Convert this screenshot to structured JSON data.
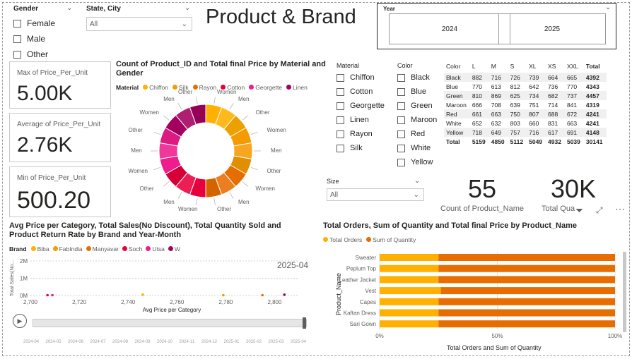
{
  "title": "Product & Brand",
  "gender_slicer": {
    "title": "Gender",
    "options": [
      "Female",
      "Male",
      "Other"
    ]
  },
  "state_slicer": {
    "title": "State, City",
    "value": "All"
  },
  "year_slicer": {
    "title": "Year",
    "options": [
      "2024",
      "2025"
    ]
  },
  "cards": [
    {
      "label": "Max of Price_Per_Unit",
      "value": "5.00K"
    },
    {
      "label": "Average of Price_Per_Unit",
      "value": "2.76K"
    },
    {
      "label": "Min of Price_Per_Unit",
      "value": "500.20"
    }
  ],
  "donut": {
    "title": "Count of Product_ID and Total final Price by Material and Gender",
    "legend_title": "Material",
    "legend": [
      "Chiffon",
      "Silk",
      "Rayon",
      "Cotton",
      "Georgette",
      "Linen"
    ],
    "colors": {
      "Chiffon": "#ffb000",
      "Silk": "#f59a00",
      "Rayon": "#e86d00",
      "Cotton": "#e8003d",
      "Georgette": "#ee1c8d",
      "Linen": "#a3005f"
    },
    "labels": [
      "Women",
      "Men",
      "Other",
      "Women",
      "Men",
      "Other",
      "Women",
      "Men",
      "Other",
      "Women",
      "Men",
      "Other",
      "Women",
      "Men",
      "Other",
      "Women",
      "Men",
      "Other"
    ]
  },
  "material_slicer": {
    "title": "Material",
    "options": [
      "Chiffon",
      "Cotton",
      "Georgette",
      "Linen",
      "Rayon",
      "Silk"
    ]
  },
  "color_slicer": {
    "title": "Color",
    "options": [
      "Black",
      "Blue",
      "Green",
      "Maroon",
      "Red",
      "White",
      "Yellow"
    ]
  },
  "size_slicer": {
    "title": "Size",
    "value": "All"
  },
  "matrix": {
    "headers": [
      "Color",
      "L",
      "M",
      "S",
      "XL",
      "XS",
      "XXL",
      "Total"
    ],
    "rows": [
      [
        "Black",
        "882",
        "716",
        "726",
        "739",
        "664",
        "665",
        "4392"
      ],
      [
        "Blue",
        "770",
        "613",
        "812",
        "642",
        "736",
        "770",
        "4343"
      ],
      [
        "Green",
        "810",
        "869",
        "625",
        "734",
        "682",
        "737",
        "4457"
      ],
      [
        "Maroon",
        "666",
        "708",
        "639",
        "751",
        "714",
        "841",
        "4319"
      ],
      [
        "Red",
        "661",
        "663",
        "750",
        "807",
        "688",
        "672",
        "4241"
      ],
      [
        "White",
        "652",
        "632",
        "803",
        "660",
        "831",
        "663",
        "4241"
      ],
      [
        "Yellow",
        "718",
        "649",
        "757",
        "716",
        "617",
        "691",
        "4148"
      ]
    ],
    "total": [
      "Total",
      "5159",
      "4850",
      "5112",
      "5049",
      "4932",
      "5039",
      "30141"
    ]
  },
  "kpi_count": {
    "value": "55",
    "label": "Count of Product_Name"
  },
  "kpi_qty": {
    "value": "30K",
    "label": "Total Qua"
  },
  "scatter": {
    "title": "Avg Price per Category, Total Sales(No Discount), Total Quantity Sold and Product Return Rate by Brand and Year-Month",
    "legend_title": "Brand",
    "legend": [
      "Biba",
      "FabIndia",
      "Manyavar",
      "Soch",
      "Utsa",
      "W"
    ],
    "colors": [
      "#ffb000",
      "#f59a00",
      "#e86d00",
      "#e8003d",
      "#ee1c8d",
      "#a3005f"
    ],
    "play_label": "2025-04",
    "ylabel": "Total Sales(No...",
    "xlabel": "Avg Price per Category",
    "timeline": [
      "2024-04",
      "2024-05",
      "2024-06",
      "2024-07",
      "2024-08",
      "2024-09",
      "2024-10",
      "2024-11",
      "2024-12",
      "2025-01",
      "2025-02",
      "2025-03",
      "2025-04"
    ]
  },
  "chart_data": [
    {
      "type": "scatter",
      "title": "Avg Price per Category, Total Sales(No Discount), Total Quantity Sold and Product Return Rate by Brand and Year-Month",
      "xlabel": "Avg Price per Category",
      "ylabel": "Total Sales(No...",
      "xlim": [
        2700,
        2810
      ],
      "ylim": [
        0,
        2
      ],
      "x_ticks": [
        "2,700",
        "2,720",
        "2,740",
        "2,760",
        "2,780",
        "2,800"
      ],
      "y_ticks": [
        "0M",
        "1M",
        "2M"
      ],
      "series": [
        {
          "name": "Biba",
          "x": [
            2746
          ],
          "y": [
            0.05
          ]
        },
        {
          "name": "FabIndia",
          "x": [
            2779
          ],
          "y": [
            0.02
          ]
        },
        {
          "name": "Manyavar",
          "x": [
            2795
          ],
          "y": [
            0.02
          ]
        },
        {
          "name": "Soch",
          "x": [
            2707
          ],
          "y": [
            0.02
          ]
        },
        {
          "name": "Utsa",
          "x": [
            2709
          ],
          "y": [
            0.02
          ]
        },
        {
          "name": "W",
          "x": [
            2804
          ],
          "y": [
            0.05
          ]
        }
      ]
    },
    {
      "type": "bar",
      "title": "Total Orders, Sum of Quantity and Total final Price by Product_Name",
      "xlabel": "Total Orders and Sum of Quantity",
      "ylabel": "Product_Name",
      "categories": [
        "Sweater",
        "Peplum Top",
        "Leather Jacket",
        "Vest",
        "Capes",
        "Kaftan Dress",
        "Sari Gown"
      ],
      "x_ticks": [
        "0%",
        "50%",
        "100%"
      ],
      "series": [
        {
          "name": "Total Orders",
          "values": [
            25,
            25,
            25,
            26,
            25,
            25,
            25
          ]
        },
        {
          "name": "Sum of Quantity",
          "values": [
            75,
            75,
            75,
            74,
            75,
            75,
            75
          ]
        }
      ],
      "colors": [
        "#ffb000",
        "#e86d00"
      ]
    }
  ]
}
